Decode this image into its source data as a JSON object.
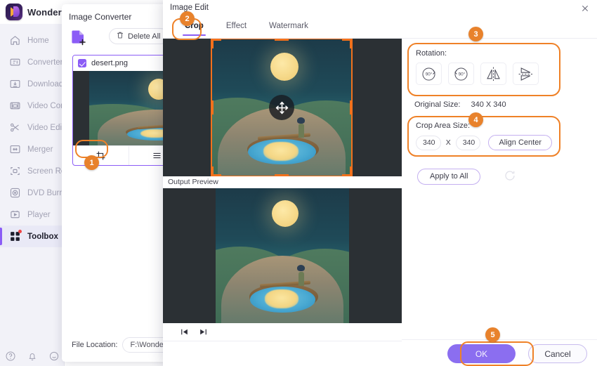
{
  "app": {
    "brand_name": "Wondershare",
    "logo_icon": "wondershare-logo-icon",
    "sidebar": {
      "items": [
        {
          "label": "Home",
          "icon": "home-icon",
          "active": false
        },
        {
          "label": "Converter",
          "icon": "converter-icon",
          "active": false
        },
        {
          "label": "Downloader",
          "icon": "download-icon",
          "active": false
        },
        {
          "label": "Video Compressor",
          "icon": "video-compressor-icon",
          "active": false
        },
        {
          "label": "Video Editor",
          "icon": "scissors-icon",
          "active": false
        },
        {
          "label": "Merger",
          "icon": "merger-icon",
          "active": false
        },
        {
          "label": "Screen Recorder",
          "icon": "screen-recorder-icon",
          "active": false
        },
        {
          "label": "DVD Burner",
          "icon": "dvd-burner-icon",
          "active": false
        },
        {
          "label": "Player",
          "icon": "player-icon",
          "active": false
        },
        {
          "label": "Toolbox",
          "icon": "toolbox-icon",
          "active": true
        }
      ],
      "bottom_icons": [
        "help-icon",
        "bell-icon",
        "feedback-icon"
      ]
    }
  },
  "converter": {
    "title": "Image Converter",
    "add_file_icon": "add-file-icon",
    "delete_all_label": "Delete All",
    "delete_all_icon": "trash-icon",
    "file": {
      "name": "desert.png",
      "checked": true,
      "tools": [
        {
          "icon": "crop-icon",
          "name": "crop-tool",
          "highlighted": true
        },
        {
          "icon": "list-icon",
          "name": "list-tool",
          "highlighted": false
        },
        {
          "icon": "effect-icon",
          "name": "effect-tool",
          "highlighted": false
        }
      ]
    },
    "file_location_label": "File Location:",
    "file_location_value": "F:\\Wondersha"
  },
  "dialog": {
    "title": "Image Edit",
    "close_icon": "close-icon",
    "tabs": [
      {
        "label": "Crop",
        "active": true
      },
      {
        "label": "Effect",
        "active": false
      },
      {
        "label": "Watermark",
        "active": false
      }
    ],
    "output_preview_label": "Output Preview",
    "playback": [
      {
        "icon": "previous-frame-icon",
        "name": "previous-frame-button"
      },
      {
        "icon": "next-frame-icon",
        "name": "next-frame-button"
      }
    ],
    "move_handle_icon": "move-icon",
    "rotation": {
      "label": "Rotation:",
      "buttons": [
        {
          "name": "rotate-right-90-button",
          "icon": "rotate-right-90-icon",
          "label": "90°"
        },
        {
          "name": "rotate-left-90-button",
          "icon": "rotate-left-90-icon",
          "label": "90°"
        },
        {
          "name": "flip-horizontal-button",
          "icon": "flip-horizontal-icon",
          "label": ""
        },
        {
          "name": "flip-vertical-button",
          "icon": "flip-vertical-icon",
          "label": ""
        }
      ]
    },
    "original_size": {
      "label": "Original Size:",
      "value": "340 X 340"
    },
    "crop_area": {
      "label": "Crop Area Size:",
      "width": "340",
      "separator": "X",
      "height": "340",
      "align_center_label": "Align Center"
    },
    "apply_to_all_label": "Apply to All",
    "reset_icon": "reset-icon",
    "ok_label": "OK",
    "cancel_label": "Cancel"
  },
  "annotations": {
    "badges": [
      {
        "number": "1",
        "target": "crop-tool"
      },
      {
        "number": "2",
        "target": "tab-crop"
      },
      {
        "number": "3",
        "target": "rotation-group"
      },
      {
        "number": "4",
        "target": "crop-area-size-group"
      },
      {
        "number": "5",
        "target": "ok-button"
      }
    ],
    "accent_color": "#ef8127",
    "brand_color": "#8b5cf6"
  }
}
